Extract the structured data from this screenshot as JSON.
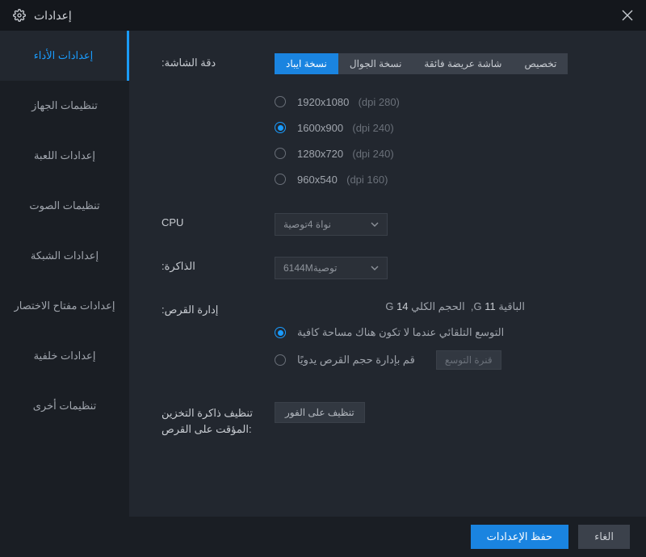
{
  "titlebar": {
    "title": "إعدادات"
  },
  "sidebar": {
    "items": [
      {
        "label": "إعدادات الأداء",
        "active": true
      },
      {
        "label": "تنظيمات الجهاز"
      },
      {
        "label": "إعدادات اللعبة"
      },
      {
        "label": "تنظيمات الصوت"
      },
      {
        "label": "إعدادات الشبكة"
      },
      {
        "label": "إعدادات مفتاح الاختصار"
      },
      {
        "label": "إعدادات خلفية"
      },
      {
        "label": "تنظيمات أخرى"
      }
    ]
  },
  "resolution": {
    "label": ":دقة الشاشة",
    "tabs": [
      {
        "label": "نسخة ايباد",
        "active": true
      },
      {
        "label": "نسخة الجوال"
      },
      {
        "label": "شاشة عريضة فائقة"
      },
      {
        "label": "تخصيص"
      }
    ],
    "options": [
      {
        "res": "1920x1080",
        "dpi": "(dpi 280)",
        "checked": false
      },
      {
        "res": "1600x900",
        "dpi": "(dpi 240)",
        "checked": true
      },
      {
        "res": "1280x720",
        "dpi": "(dpi 240)",
        "checked": false
      },
      {
        "res": "960x540",
        "dpi": "(dpi 160)",
        "checked": false
      }
    ]
  },
  "cpu": {
    "label": "CPU",
    "value": "نواة 4توصية"
  },
  "memory": {
    "label": ":الذاكرة",
    "value": "6144Mتوصية"
  },
  "disk": {
    "label": ":إدارة القرص",
    "remaining_label": "الباقية",
    "remaining_value": "11",
    "unit": "G,",
    "total_label": "الحجم الكلي",
    "total_value": "14",
    "total_unit": "G",
    "auto_label": "التوسع التلقائي عندما لا تكون هناك مساحة كافية",
    "manual_label": "قم بإدارة حجم القرص يدويًا",
    "expand_btn": "قنرة التوسع"
  },
  "cache": {
    "label": "تنظيف ذاكرة التخزين المؤقت على القرص:",
    "btn": "تنظيف على الفور"
  },
  "footer": {
    "save": "حفظ الإعدادات",
    "cancel": "الغاء"
  }
}
